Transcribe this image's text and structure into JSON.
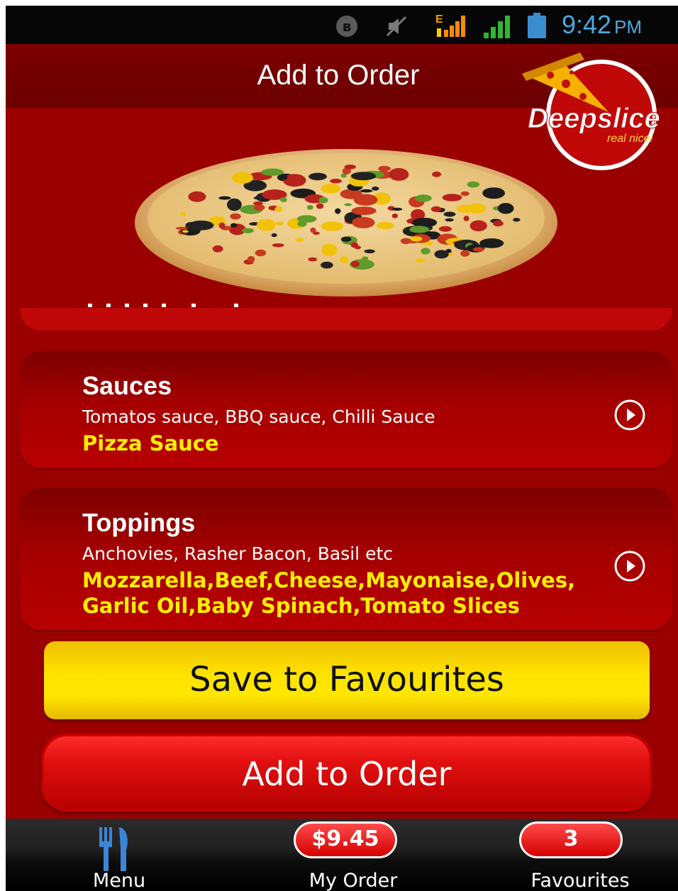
{
  "status_bar": {
    "time": "9:42",
    "ampm": "PM",
    "network_label": "E",
    "icons": [
      "bluetooth-icon",
      "mute-icon",
      "edge-signal-icon",
      "signal-icon",
      "battery-icon"
    ]
  },
  "header": {
    "title": "Add to Order"
  },
  "logo": {
    "name": "Deepslice",
    "tagline": "real nice!"
  },
  "options": [
    {
      "title": "Sauces",
      "description": "Tomatos sauce, BBQ sauce, Chilli Sauce",
      "selected": "Pizza Sauce"
    },
    {
      "title": "Toppings",
      "description": "Anchovies, Rasher Bacon, Basil etc",
      "selected_line1": "Mozzarella,Beef,Cheese,Mayonaise,Olives,",
      "selected_line2": "Garlic Oil,Baby Spinach,Tomato Slices"
    }
  ],
  "buttons": {
    "save_favourites": "Save to Favourites",
    "add_to_order": "Add to Order"
  },
  "bottom_nav": {
    "menu_label": "Menu",
    "order_label": "My Order",
    "order_total": "$9.45",
    "favourites_label": "Favourites",
    "favourites_count": "3"
  },
  "colors": {
    "background": "#9a0000",
    "header": "#6b0000",
    "highlight_text": "#ffee00",
    "fav_button": "#ffe400",
    "add_button": "#e21010",
    "clock": "#4aa8e0"
  }
}
